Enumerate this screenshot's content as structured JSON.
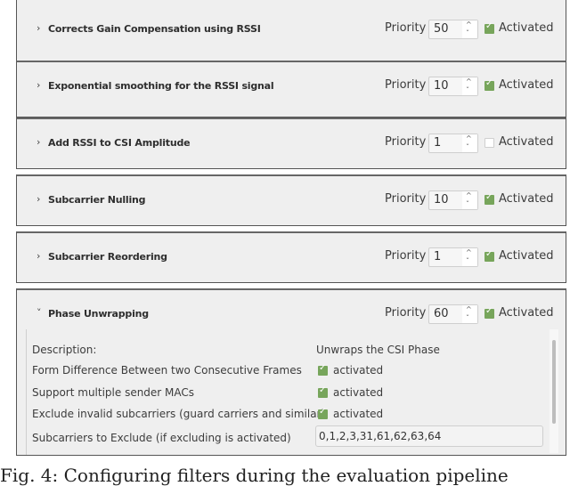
{
  "filters": [
    {
      "title": "Corrects Gain Compensation using RSSI",
      "expanded": false,
      "priority_label": "Priority",
      "priority": "50",
      "activated_label": "Activated",
      "activated": true
    },
    {
      "title": "Exponential smoothing for the RSSI signal",
      "expanded": false,
      "priority_label": "Priority",
      "priority": "10",
      "activated_label": "Activated",
      "activated": true
    },
    {
      "title": "Add RSSI to CSI Amplitude",
      "expanded": false,
      "priority_label": "Priority",
      "priority": "1",
      "activated_label": "Activated",
      "activated": false
    },
    {
      "title": "Subcarrier Nulling",
      "expanded": false,
      "priority_label": "Priority",
      "priority": "10",
      "activated_label": "Activated",
      "activated": true
    },
    {
      "title": "Subcarrier Reordering",
      "expanded": false,
      "priority_label": "Priority",
      "priority": "1",
      "activated_label": "Activated",
      "activated": true
    },
    {
      "title": "Phase Unwrapping",
      "expanded": true,
      "priority_label": "Priority",
      "priority": "60",
      "activated_label": "Activated",
      "activated": true
    }
  ],
  "details": {
    "description_label": "Description:",
    "description_value": "Unwraps the CSI Phase",
    "form_difference_label": "Form Difference Between two Consecutive Frames",
    "form_difference_value": "activated",
    "multi_mac_label": "Support multiple sender MACs",
    "multi_mac_value": "activated",
    "exclude_invalid_label": "Exclude invalid subcarriers (guard carriers and similar)",
    "exclude_invalid_value": "activated",
    "subcarriers_label": "Subcarriers to Exclude (if excluding is activated)",
    "subcarriers_value": "0,1,2,3,31,61,62,63,64"
  },
  "icons": {
    "collapsed": "›",
    "expanded": "˅",
    "up": "^",
    "down": "ˇ"
  },
  "colors": {
    "checkbox_on": "#77a55b",
    "panel_bg": "#efefef"
  },
  "caption": "Fig. 4: Configuring filters during the evaluation pipeline"
}
